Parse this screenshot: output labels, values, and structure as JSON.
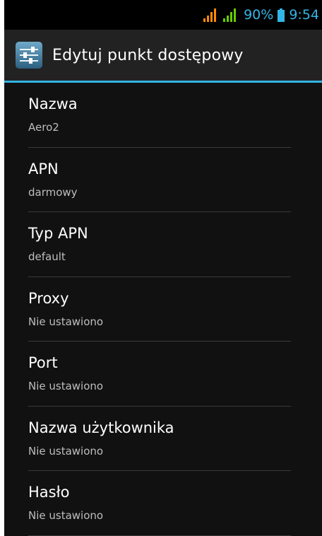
{
  "status_bar": {
    "battery": "90%",
    "time": "9:54",
    "colors": {
      "signal_1": "#ff8a00",
      "signal_2": "#66cc00",
      "accent": "#33b5e5"
    }
  },
  "action_bar": {
    "title": "Edytuj punkt dostępowy",
    "icon": "settings-sliders-icon"
  },
  "items": [
    {
      "title": "Nazwa",
      "value": "Aero2"
    },
    {
      "title": "APN",
      "value": "darmowy"
    },
    {
      "title": "Typ APN",
      "value": "default"
    },
    {
      "title": "Proxy",
      "value": "Nie ustawiono"
    },
    {
      "title": "Port",
      "value": "Nie ustawiono"
    },
    {
      "title": "Nazwa użytkownika",
      "value": "Nie ustawiono"
    },
    {
      "title": "Hasło",
      "value": "Nie ustawiono"
    }
  ]
}
